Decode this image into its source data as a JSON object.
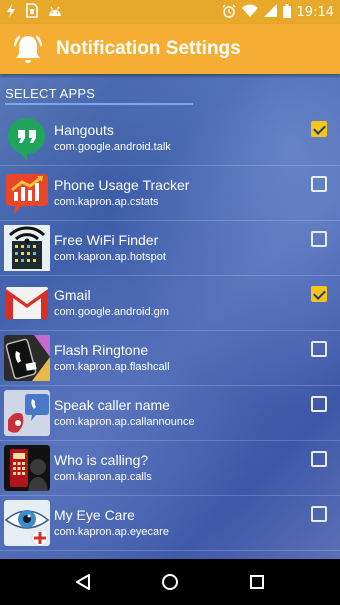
{
  "status_bar": {
    "time": "19:14",
    "icons": [
      "flash-icon",
      "sim-icon",
      "android-icon",
      "alarm-icon",
      "wifi-icon",
      "signal-icon",
      "battery-icon"
    ]
  },
  "app_bar": {
    "title": "Notification Settings",
    "icon": "bell-icon",
    "color": "#f5ad34"
  },
  "section": {
    "title": "SELECT APPS"
  },
  "apps": [
    {
      "name": "Hangouts",
      "package": "com.google.android.talk",
      "checked": true,
      "icon": "hangouts-icon"
    },
    {
      "name": "Phone Usage Tracker",
      "package": "com.kapron.ap.cstats",
      "checked": false,
      "icon": "usage-tracker-icon"
    },
    {
      "name": "Free WiFi Finder",
      "package": "com.kapron.ap.hotspot",
      "checked": false,
      "icon": "wifi-finder-icon"
    },
    {
      "name": "Gmail",
      "package": "com.google.android.gm",
      "checked": true,
      "icon": "gmail-icon"
    },
    {
      "name": "Flash Ringtone",
      "package": "com.kapron.ap.flashcall",
      "checked": false,
      "icon": "flash-ringtone-icon"
    },
    {
      "name": "Speak caller name",
      "package": "com.kapron.ap.callannounce",
      "checked": false,
      "icon": "speak-caller-icon"
    },
    {
      "name": "Who is calling?",
      "package": "com.kapron.ap.calls",
      "checked": false,
      "icon": "who-calling-icon"
    },
    {
      "name": "My Eye Care",
      "package": "com.kapron.ap.eyecare",
      "checked": false,
      "icon": "eye-care-icon"
    }
  ],
  "nav_bar": {
    "buttons": [
      "back-icon",
      "home-icon",
      "recents-icon"
    ]
  }
}
